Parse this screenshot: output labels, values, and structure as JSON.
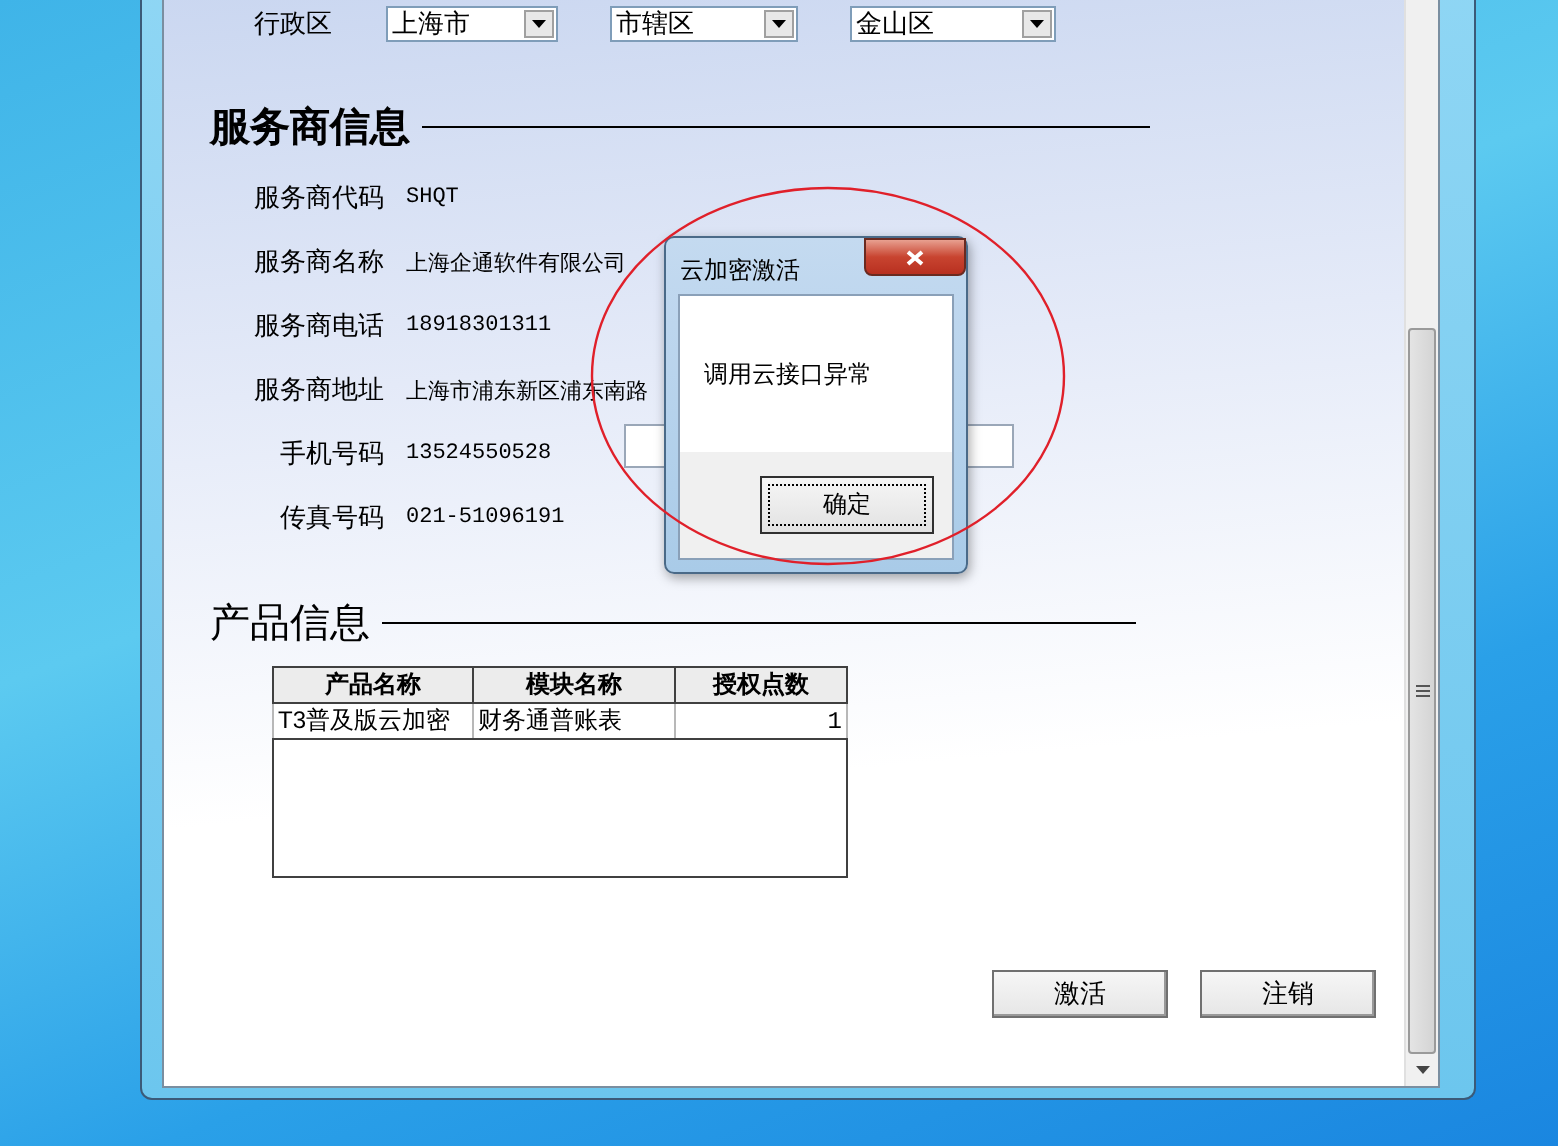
{
  "window": {
    "region": {
      "label": "行政区",
      "selects": [
        {
          "value": "上海市"
        },
        {
          "value": "市辖区"
        },
        {
          "value": "金山区"
        }
      ]
    },
    "provider_section": {
      "title": "服务商信息",
      "fields": [
        {
          "label": "服务商代码",
          "value": "SHQT"
        },
        {
          "label": "服务商名称",
          "value": "上海企通软件有限公司"
        },
        {
          "label": "服务商电话",
          "value": "18918301311"
        },
        {
          "label": "服务商地址",
          "value": "上海市浦东新区浦东南路"
        },
        {
          "label": "手机号码",
          "value": "13524550528"
        },
        {
          "label": "传真号码",
          "value": "021-51096191"
        }
      ]
    },
    "product_section": {
      "title": "产品信息",
      "table": {
        "columns": [
          "产品名称",
          "模块名称",
          "授权点数"
        ],
        "rows": [
          [
            "T3普及版云加密",
            "财务通普账表",
            "1"
          ]
        ]
      }
    },
    "buttons": [
      "激活",
      "注销"
    ]
  },
  "dialog": {
    "title": "云加密激活",
    "message": "调用云接口异常",
    "button": "确定"
  }
}
